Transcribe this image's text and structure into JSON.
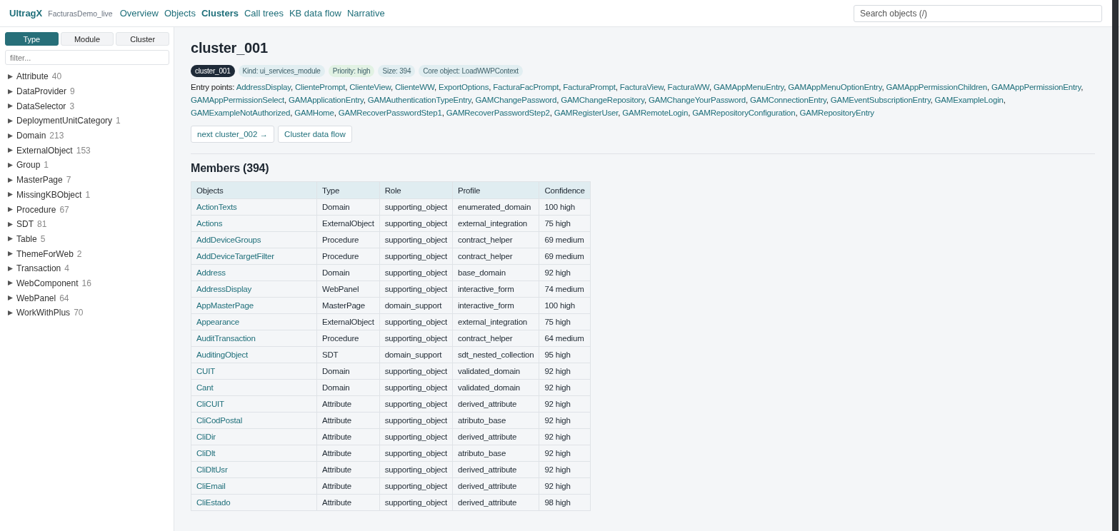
{
  "header": {
    "brand": "UltragX",
    "project": "FacturasDemo_live",
    "nav": [
      {
        "label": "Overview",
        "selected": false
      },
      {
        "label": "Objects",
        "selected": false
      },
      {
        "label": "Clusters",
        "selected": true
      },
      {
        "label": "Call trees",
        "selected": false
      },
      {
        "label": "KB data flow",
        "selected": false
      },
      {
        "label": "Narrative",
        "selected": false
      }
    ],
    "search": {
      "placeholder": "Search objects (/)"
    }
  },
  "sidebar": {
    "tabs": [
      {
        "label": "Type",
        "selected": true
      },
      {
        "label": "Module",
        "selected": false
      },
      {
        "label": "Cluster",
        "selected": false
      }
    ],
    "filter": {
      "placeholder": "filter..."
    },
    "items": [
      {
        "label": "Attribute",
        "count": "40",
        "expanded": false
      },
      {
        "label": "DataProvider",
        "count": "9",
        "expanded": false
      },
      {
        "label": "DataSelector",
        "count": "3",
        "expanded": false
      },
      {
        "label": "DeploymentUnitCategory",
        "count": "1",
        "expanded": false
      },
      {
        "label": "Domain",
        "count": "213",
        "expanded": false
      },
      {
        "label": "ExternalObject",
        "count": "153",
        "expanded": false
      },
      {
        "label": "Group",
        "count": "1",
        "expanded": false
      },
      {
        "label": "MasterPage",
        "count": "7",
        "expanded": false
      },
      {
        "label": "MissingKBObject",
        "count": "1",
        "expanded": false
      },
      {
        "label": "Procedure",
        "count": "67",
        "expanded": false
      },
      {
        "label": "SDT",
        "count": "81",
        "expanded": false
      },
      {
        "label": "Table",
        "count": "5",
        "expanded": false
      },
      {
        "label": "ThemeForWeb",
        "count": "2",
        "expanded": false
      },
      {
        "label": "Transaction",
        "count": "4",
        "expanded": false
      },
      {
        "label": "WebComponent",
        "count": "16",
        "expanded": false
      },
      {
        "label": "WebPanel",
        "count": "64",
        "expanded": false
      },
      {
        "label": "WorkWithPlus",
        "count": "70",
        "expanded": false
      }
    ]
  },
  "cluster": {
    "title": "cluster_001",
    "tags": [
      {
        "label": "cluster_001",
        "color": "#1e2a38"
      },
      {
        "label": "Kind: ui_services_module",
        "color": "#e1eef1"
      },
      {
        "label": "Priority: high",
        "color": "#e2f2e4"
      },
      {
        "label": "Size: 394",
        "color": "#e1eef1"
      },
      {
        "label": "Core object: LoadWWPContext",
        "color": "#e1eef1"
      }
    ],
    "entry_points_label": "Entry points:",
    "separator": ", ",
    "entry_points": [
      "AddressDisplay",
      "ClientePrompt",
      "ClienteView",
      "ClienteWW",
      "ExportOptions",
      "FacturaFacPrompt",
      "FacturaPrompt",
      "FacturaView",
      "FacturaWW",
      "GAMAppMenuEntry",
      "GAMAppMenuOptionEntry",
      "GAMAppPermissionChildren",
      "GAMAppPermissionEntry",
      "GAMAppPermissionSelect",
      "GAMApplicationEntry",
      "GAMAuthenticationTypeEntry",
      "GAMChangePassword",
      "GAMChangeRepository",
      "GAMChangeYourPassword",
      "GAMConnectionEntry",
      "GAMEventSubscriptionEntry",
      "GAMExampleLogin",
      "GAMExampleNotAuthorized",
      "GAMHome",
      "GAMRecoverPasswordStep1",
      "GAMRecoverPasswordStep2",
      "GAMRegisterUser",
      "GAMRemoteLogin",
      "GAMRepositoryConfiguration",
      "GAMRepositoryEntry"
    ],
    "buttons": [
      "next cluster_002 →",
      "Cluster data flow"
    ],
    "members_title": "Members (394)",
    "table": {
      "columns": [
        "Objects",
        "Type",
        "Role",
        "Profile",
        "Confidence"
      ],
      "rows": [
        [
          "ActionTexts",
          "Domain",
          "supporting_object",
          "enumerated_domain",
          "100 high"
        ],
        [
          "Actions",
          "ExternalObject",
          "supporting_object",
          "external_integration",
          "75 high"
        ],
        [
          "AddDeviceGroups",
          "Procedure",
          "supporting_object",
          "contract_helper",
          "69 medium"
        ],
        [
          "AddDeviceTargetFilter",
          "Procedure",
          "supporting_object",
          "contract_helper",
          "69 medium"
        ],
        [
          "Address",
          "Domain",
          "supporting_object",
          "base_domain",
          "92 high"
        ],
        [
          "AddressDisplay",
          "WebPanel",
          "supporting_object",
          "interactive_form",
          "74 medium"
        ],
        [
          "AppMasterPage",
          "MasterPage",
          "domain_support",
          "interactive_form",
          "100 high"
        ],
        [
          "Appearance",
          "ExternalObject",
          "supporting_object",
          "external_integration",
          "75 high"
        ],
        [
          "AuditTransaction",
          "Procedure",
          "supporting_object",
          "contract_helper",
          "64 medium"
        ],
        [
          "AuditingObject",
          "SDT",
          "domain_support",
          "sdt_nested_collection",
          "95 high"
        ],
        [
          "CUIT",
          "Domain",
          "supporting_object",
          "validated_domain",
          "92 high"
        ],
        [
          "Cant",
          "Domain",
          "supporting_object",
          "validated_domain",
          "92 high"
        ],
        [
          "CliCUIT",
          "Attribute",
          "supporting_object",
          "derived_attribute",
          "92 high"
        ],
        [
          "CliCodPostal",
          "Attribute",
          "supporting_object",
          "atributo_base",
          "92 high"
        ],
        [
          "CliDir",
          "Attribute",
          "supporting_object",
          "derived_attribute",
          "92 high"
        ],
        [
          "CliDlt",
          "Attribute",
          "supporting_object",
          "atributo_base",
          "92 high"
        ],
        [
          "CliDltUsr",
          "Attribute",
          "supporting_object",
          "derived_attribute",
          "92 high"
        ],
        [
          "CliEmail",
          "Attribute",
          "supporting_object",
          "derived_attribute",
          "92 high"
        ],
        [
          "CliEstado",
          "Attribute",
          "supporting_object",
          "derived_attribute",
          "98 high"
        ]
      ]
    }
  }
}
